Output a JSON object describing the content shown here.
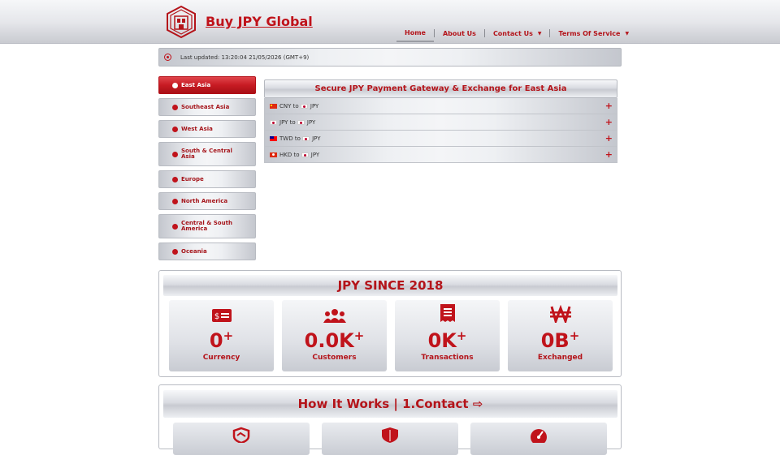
{
  "header": {
    "brand": "Buy JPY Global",
    "logo_icon": "building-logo-icon",
    "nav": [
      {
        "label": "Home",
        "active": true
      },
      {
        "label": "About Us"
      },
      {
        "label": "Contact Us",
        "dropdown": true
      },
      {
        "label": "Terms Of Service",
        "dropdown": true
      }
    ]
  },
  "update": {
    "icon": "clock-icon",
    "text": "Last updated: 13:20:04 21/05/2026 (GMT+9)"
  },
  "sidebar": {
    "items": [
      {
        "label": "East Asia",
        "active": true
      },
      {
        "label": "Southeast Asia"
      },
      {
        "label": "West Asia"
      },
      {
        "label": "South & Central Asia"
      },
      {
        "label": "Europe"
      },
      {
        "label": "North America"
      },
      {
        "label": "Central & South America"
      },
      {
        "label": "Oceania"
      }
    ]
  },
  "panel": {
    "title": "Secure JPY Payment Gateway & Exchange for East Asia",
    "rows": [
      {
        "from": "CNY",
        "to": "JPY",
        "connector": "to"
      },
      {
        "from": "JPY",
        "to": "JPY",
        "connector": "to"
      },
      {
        "from": "TWD",
        "to": "JPY",
        "connector": "to"
      },
      {
        "from": "HKD",
        "to": "JPY",
        "connector": "to"
      }
    ]
  },
  "stats": {
    "title": "JPY SINCE 2018",
    "cards": [
      {
        "value": "0",
        "suffix": "+",
        "label": "Currency",
        "icon": "money-bill-icon"
      },
      {
        "value": "0.0K",
        "suffix": "+",
        "label": "Customers",
        "icon": "users-icon"
      },
      {
        "value": "0K",
        "suffix": "+",
        "label": "Transactions",
        "icon": "receipt-icon"
      },
      {
        "value": "0B",
        "suffix": "+",
        "label": "Exchanged",
        "icon": "won-sign-icon"
      }
    ]
  },
  "how": {
    "title": "How It Works | 1.Contact ⇨",
    "cards": [
      {
        "icon": "handshake-shield-icon"
      },
      {
        "icon": "shield-icon"
      },
      {
        "icon": "gauge-icon"
      }
    ]
  },
  "colors": {
    "accent": "#c0131b",
    "accent_text": "#b4141a",
    "metal_light": "#f6f7f9",
    "metal_dark": "#c8cad1"
  }
}
